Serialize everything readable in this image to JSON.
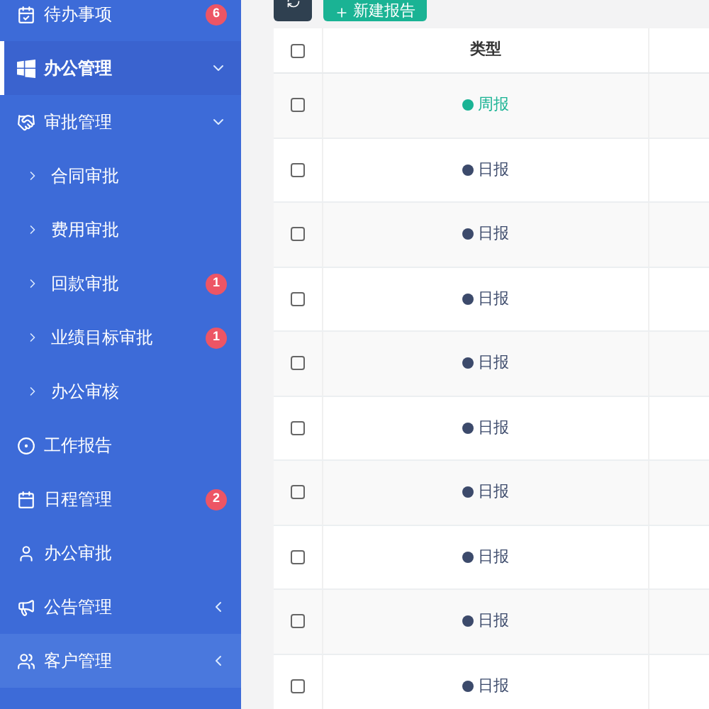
{
  "sidebar": {
    "items": [
      {
        "label": "待办事项",
        "kind": "todo",
        "badge": "6",
        "selected": false
      },
      {
        "label": "办公管理",
        "kind": "office",
        "selected": true,
        "expanded": true,
        "children": [
          {
            "label": "审批管理",
            "kind": "approval",
            "selected": false,
            "expanded": true,
            "children": [
              {
                "label": "合同审批",
                "selected": false
              },
              {
                "label": "费用审批",
                "selected": false
              },
              {
                "label": "回款审批",
                "badge": "1",
                "selected": false
              },
              {
                "label": "业绩目标审批",
                "badge": "1",
                "selected": false
              },
              {
                "label": "办公审核",
                "selected": false
              }
            ]
          },
          {
            "label": "工作报告",
            "kind": "report",
            "selected": false
          },
          {
            "label": "日程管理",
            "kind": "schedule",
            "badge": "2",
            "selected": false
          },
          {
            "label": "办公审批",
            "kind": "person",
            "selected": false
          },
          {
            "label": "公告管理",
            "kind": "notice",
            "selected": false,
            "expanded": false
          }
        ]
      },
      {
        "label": "客户管理",
        "kind": "customers",
        "selected": false,
        "expanded": false,
        "hovered": true
      }
    ]
  },
  "toolbar": {
    "buttons": [
      {
        "kind": "refresh"
      },
      {
        "kind": "add",
        "label": "新建报告"
      }
    ]
  },
  "table": {
    "header_checked": false,
    "columns": [
      "类型"
    ],
    "rows": [
      {
        "type": "周报",
        "color": "#1ab394",
        "checked": false
      },
      {
        "type": "日报",
        "color": "#3c4a6b",
        "checked": false
      },
      {
        "type": "日报",
        "color": "#3c4a6b",
        "checked": false
      },
      {
        "type": "日报",
        "color": "#3c4a6b",
        "checked": false
      },
      {
        "type": "日报",
        "color": "#3c4a6b",
        "checked": false
      },
      {
        "type": "日报",
        "color": "#3c4a6b",
        "checked": false
      },
      {
        "type": "日报",
        "color": "#3c4a6b",
        "checked": false
      },
      {
        "type": "日报",
        "color": "#3c4a6b",
        "checked": false
      },
      {
        "type": "日报",
        "color": "#3c4a6b",
        "checked": false
      },
      {
        "type": "日报",
        "color": "#3c4a6b",
        "checked": false
      }
    ]
  }
}
